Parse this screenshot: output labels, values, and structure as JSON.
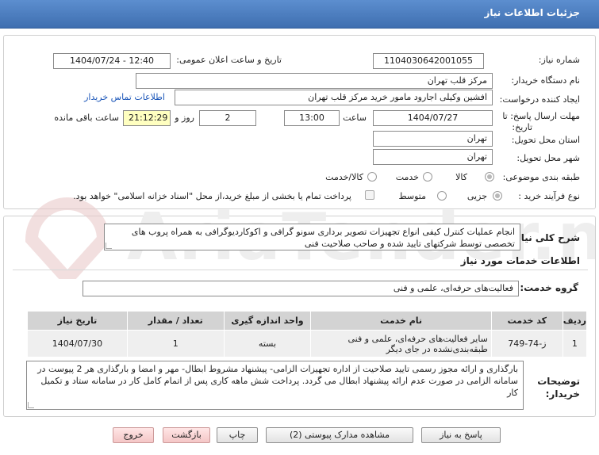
{
  "header": {
    "title": "جزئیات اطلاعات نیاز"
  },
  "fields": {
    "need_number_label": "شماره نیاز:",
    "need_number": "1104030642001055",
    "announce_label": "تاریخ و ساعت اعلان عمومی:",
    "announce_value": "1404/07/24 - 12:40",
    "buyer_label": "نام دستگاه خریدار:",
    "buyer": "مرکز قلب تهران",
    "creator_label": "ایجاد کننده درخواست:",
    "creator": "افشین وکیلی اجارود مامور خرید مرکز قلب تهران",
    "contact_link": "اطلاعات تماس خریدار",
    "deadline_label_1": "مهلت ارسال پاسخ: تا",
    "deadline_label_2": "تاریخ:",
    "deadline_date": "1404/07/27",
    "time_label": "ساعت",
    "deadline_time": "13:00",
    "days": "2",
    "days_label": "روز و",
    "remaining": "21:12:29",
    "remaining_label": "ساعت باقی مانده",
    "province_label": "استان محل تحویل:",
    "province": "تهران",
    "city_label": "شهر محل تحویل:",
    "city": "تهران",
    "category_label": "طبقه بندی موضوعی:",
    "category_options": {
      "goods": "کالا",
      "service": "خدمت",
      "goods_service": "کالا/خدمت"
    },
    "process_label": "نوع فرآیند خرید :",
    "process_options": {
      "minor": "جزیی",
      "medium": "متوسط"
    },
    "payment_note": "پرداخت تمام یا بخشی از مبلغ خرید،از محل \"اسناد خزانه اسلامی\" خواهد بود."
  },
  "summary": {
    "label": "شرح کلی نیاز:",
    "text": "انجام عملیات کنترل کیفی انواع تجهیزات تصویر برداری سونو گرافی و اکوکاردیوگرافی به همراه پروب های تخصصی توسط شرکتهای تایید شده و صاحب صلاحیت فنی"
  },
  "services": {
    "title": "اطلاعات خدمات مورد نیاز",
    "group_label": "گروه خدمت:",
    "group_value": "فعالیت‌های حرفه‌ای، علمی و فنی"
  },
  "table": {
    "headers": [
      "ردیف",
      "کد خدمت",
      "نام خدمت",
      "واحد اندازه گیری",
      "تعداد / مقدار",
      "تاریخ نیاز"
    ],
    "rows": [
      [
        "1",
        "ز-74-749",
        "سایر فعالیت‌های حرفه‌ای، علمی و فنی طبقه‌بندی‌نشده در جای دیگر",
        "بسته",
        "1",
        "1404/07/30"
      ]
    ]
  },
  "notes": {
    "label_1": "توضیحات",
    "label_2": "خریدار:",
    "text": "بارگذاری و ارائه مجوز رسمی تایید صلاحیت از اداره تجهیزات الزامی- پیشنهاد مشروط ابطال- مهر و امضا و بارگذاری هر 2 پیوست در سامانه الزامی در صورت عدم ارائه پیشنهاد ابطال می گردد. پرداخت شش ماهه کاری پس از اتمام کامل کار در سامانه ستاد و تکمیل کار"
  },
  "buttons": {
    "reply": "پاسخ به نیاز",
    "attachments": "مشاهده مدارک پیوستی (2)",
    "print": "چاپ",
    "back": "بازگشت",
    "exit": "خروج"
  },
  "colors": {
    "header": "#4a7cc0",
    "highlight": "#ffffc0",
    "link": "#1a55b8"
  }
}
